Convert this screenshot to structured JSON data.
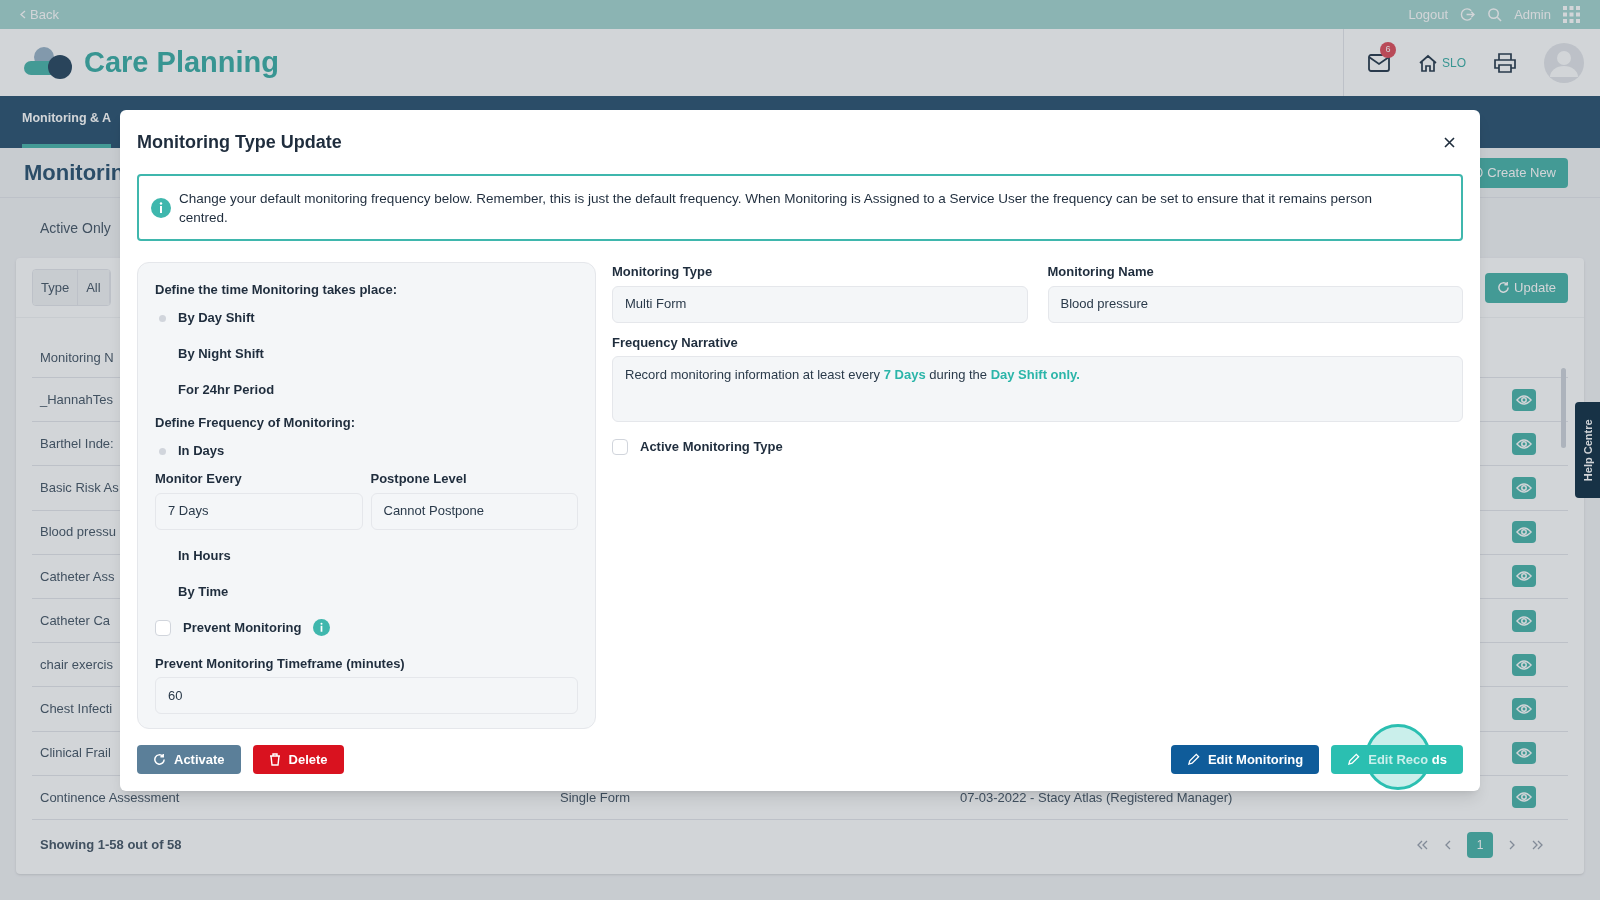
{
  "top_bar": {
    "back": "Back",
    "logout": "Logout",
    "user": "Admin"
  },
  "header": {
    "app_title": "Care Planning",
    "mail_count": "6",
    "home_label": "SLO"
  },
  "nav_tabs": [
    {
      "label": "Monitoring & A",
      "selected": true
    }
  ],
  "page": {
    "title": "Monitorin",
    "create_button": "Create New",
    "filter": "Active Only",
    "segments": [
      {
        "label": "Type"
      },
      {
        "label": "All"
      }
    ],
    "update_button": "Update"
  },
  "table": {
    "columns": [
      "Monitoring N"
    ],
    "rows": [
      {
        "name": "_HannahTes"
      },
      {
        "name": "Barthel Inde:"
      },
      {
        "name": "Basic Risk As"
      },
      {
        "name": "Blood pressu"
      },
      {
        "name": "Catheter Ass"
      },
      {
        "name": "Catheter Ca"
      },
      {
        "name": "chair exercis"
      },
      {
        "name": "Chest Infecti"
      },
      {
        "name": "Clinical Frail"
      },
      {
        "name": "Continence Assessment",
        "column_2": "Single Form",
        "column_3": "07-03-2022 - Stacy Atlas (Registered Manager)"
      }
    ],
    "footer": "Showing 1-58 out of 58",
    "pages": [
      {
        "label": "1",
        "selected": true
      }
    ]
  },
  "help_tab": "Help Centre",
  "modal": {
    "title": "Monitoring Type Update",
    "info": "Change your default monitoring frequency below. Remember, this is just the default frequency. When Monitoring is Assigned to a Service User the frequency can be set to ensure that it remains person centred.",
    "time_label": "Define the time Monitoring takes place:",
    "time_options": [
      {
        "label": "By Day Shift",
        "selected": true
      },
      {
        "label": "By Night Shift",
        "selected": false
      },
      {
        "label": "For 24hr Period",
        "selected": false
      }
    ],
    "frequency_label": "Define Frequency of Monitoring:",
    "frequency_options": [
      {
        "label": "In Days",
        "selected": true
      },
      {
        "label": "In Hours",
        "selected": false
      },
      {
        "label": "By Time",
        "selected": false
      }
    ],
    "monitor_every": {
      "label": "Monitor Every",
      "value": "7 Days"
    },
    "postpone_level": {
      "label": "Postpone Level",
      "value": "Cannot Postpone"
    },
    "prevent_monitoring": {
      "label": "Prevent Monitoring",
      "checked": false
    },
    "timeframe": {
      "label": "Prevent Monitoring Timeframe (minutes)",
      "value": "60"
    },
    "monitoring_type": {
      "label": "Monitoring Type",
      "value": "Multi Form"
    },
    "monitoring_name": {
      "label": "Monitoring Name",
      "value": "Blood pressure"
    },
    "narrative": {
      "label": "Frequency Narrative",
      "value": "Record monitoring information at least every **7 Days** during the **Day Shift only.**"
    },
    "active_type": {
      "label": "Active Monitoring Type",
      "checked": false
    },
    "buttons": [
      {
        "kind": "activate",
        "label": "Activate"
      },
      {
        "kind": "delete",
        "label": "Delete"
      },
      {
        "kind": "edit",
        "label": "Edit Monitoring"
      },
      {
        "kind": "records",
        "label": "Edit Reco ds"
      }
    ]
  }
}
